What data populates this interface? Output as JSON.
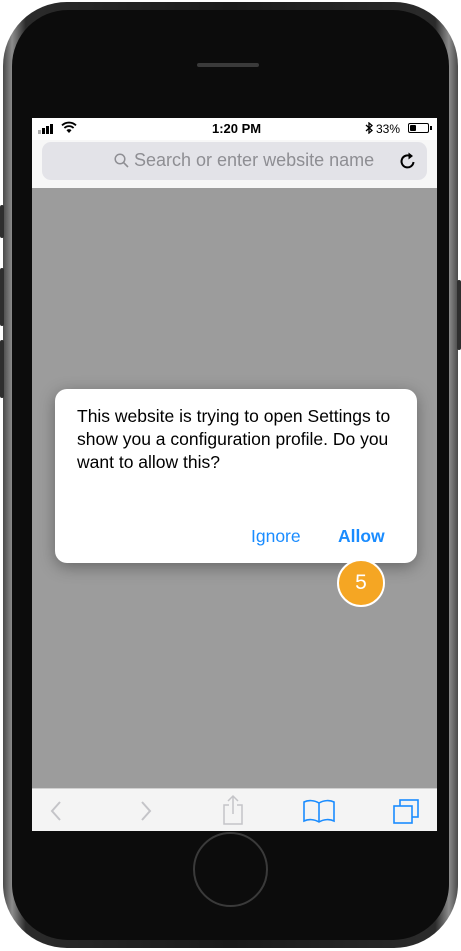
{
  "status_bar": {
    "time": "1:20 PM",
    "battery_percent": "33%",
    "battery_level": 0.33
  },
  "url_bar": {
    "placeholder": "Search or enter website name"
  },
  "icons": {
    "search": "search-icon",
    "reload": "reload-icon",
    "back": "chevron-left-icon",
    "forward": "chevron-right-icon",
    "share": "share-icon",
    "bookmarks": "book-icon",
    "tabs": "tabs-icon"
  },
  "alert": {
    "message": "This website is trying to open Settings to show you a configuration profile. Do you want to allow this?",
    "ignore_label": "Ignore",
    "allow_label": "Allow"
  },
  "step_badge": {
    "number": "5"
  },
  "colors": {
    "accent": "#1a8cff",
    "badge": "#f5a623",
    "content_background": "#9c9c9c"
  }
}
